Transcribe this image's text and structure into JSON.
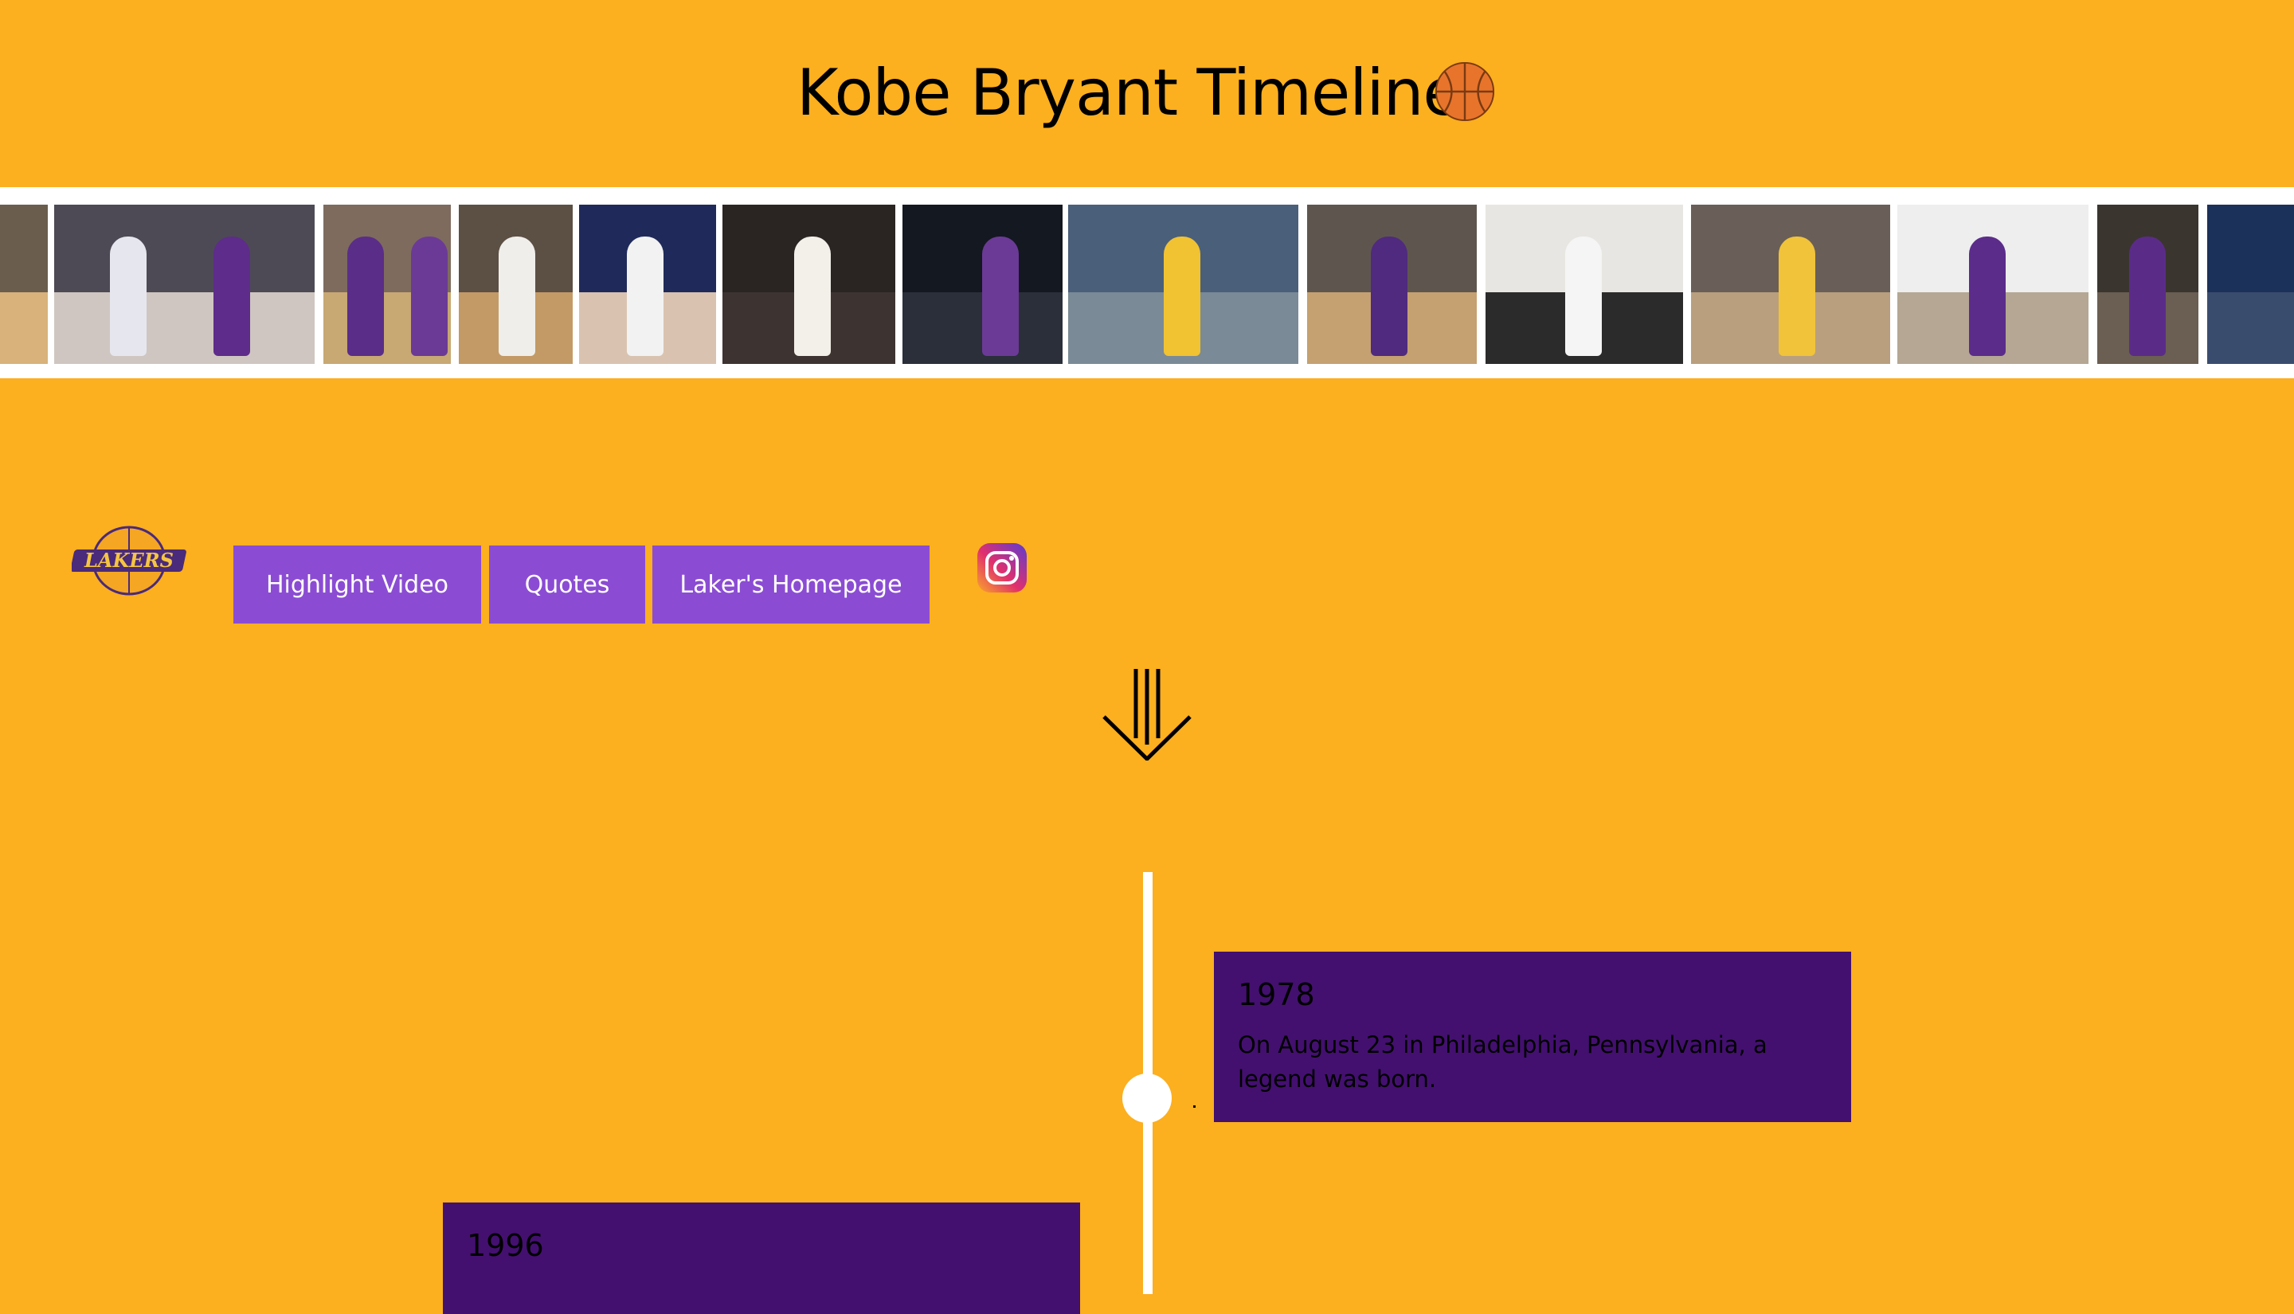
{
  "header": {
    "title": "Kobe Bryant Timeline"
  },
  "nav": {
    "highlight_label": "Highlight Video",
    "quotes_label": "Quotes",
    "homepage_label": "Laker's Homepage"
  },
  "timeline": {
    "entries": [
      {
        "year": "1978",
        "text": "On August 23 in Philadelphia, Pennsylvania, a legend was born."
      },
      {
        "year": "1996",
        "text": ""
      }
    ]
  },
  "colors": {
    "background": "#fcaf1f",
    "nav_button": "#8b4cd3",
    "card": "#43106f",
    "line": "#ffffff"
  },
  "icons": [
    "basketball-icon",
    "lakers-logo",
    "instagram-icon",
    "down-arrow-icon"
  ]
}
